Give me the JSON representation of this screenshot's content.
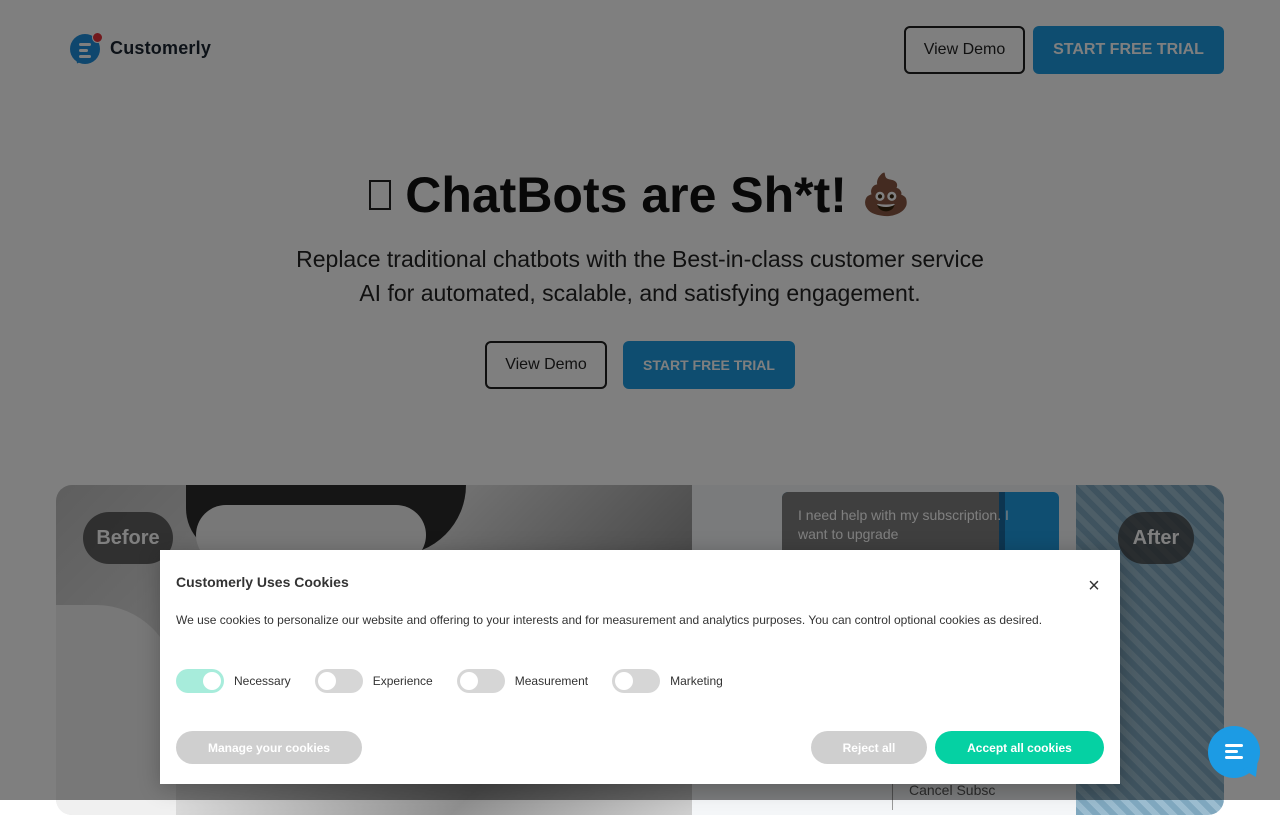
{
  "brand": {
    "name": "Customerly"
  },
  "header": {
    "demo_label": "View Demo",
    "trial_label": "START FREE TRIAL"
  },
  "hero": {
    "title": "ChatBots are Sh*t!",
    "title_emoji": "💩",
    "subtitle": "Replace traditional chatbots with the Best-in-class customer service AI for automated, scalable, and satisfying engagement.",
    "demo_label": "View Demo",
    "trial_label": "START FREE TRIAL"
  },
  "media": {
    "before_label": "Before",
    "after_label": "After",
    "chat_message": "I need help with my subscription. I want to upgrade",
    "cancel_text": "Cancel Subsc"
  },
  "cookie": {
    "title": "Customerly Uses Cookies",
    "close_icon": "×",
    "description": "We use cookies to personalize our website and offering to your interests and for measurement and analytics purposes. You can control optional cookies as desired.",
    "toggles": [
      {
        "label": "Necessary",
        "on": true
      },
      {
        "label": "Experience",
        "on": false
      },
      {
        "label": "Measurement",
        "on": false
      },
      {
        "label": "Marketing",
        "on": false
      }
    ],
    "manage_label": "Manage your cookies",
    "reject_label": "Reject all",
    "accept_label": "Accept all cookies"
  },
  "colors": {
    "primary": "#1d9be0",
    "accept": "#05d1a3",
    "toggle_on": "#a7ecdb",
    "overlay": "rgba(0,0,0,0.5)"
  },
  "icons": {
    "logo": "customerly-logo-icon",
    "launcher": "chat-launcher-icon",
    "missing_glyph": "missing-glyph-icon"
  }
}
